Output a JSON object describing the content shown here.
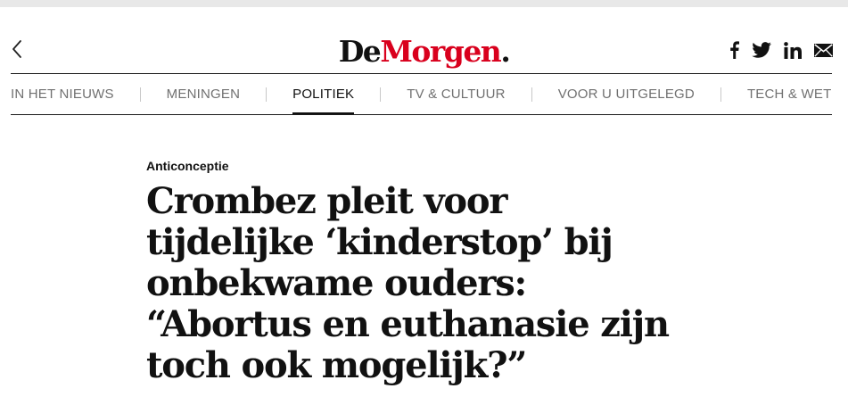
{
  "header": {
    "back_icon": "chevron-left-icon",
    "logo": {
      "part1": "De",
      "part2": "Morgen",
      "dot": ".",
      "brand_color": "#d9001d"
    },
    "share_icons": [
      "facebook-icon",
      "twitter-icon",
      "linkedin-icon",
      "mail-icon"
    ]
  },
  "nav": {
    "items": [
      {
        "label": "IN HET NIEUWS",
        "active": false
      },
      {
        "label": "MENINGEN",
        "active": false
      },
      {
        "label": "POLITIEK",
        "active": true
      },
      {
        "label": "TV & CULTUUR",
        "active": false
      },
      {
        "label": "VOOR U UITGELEGD",
        "active": false
      },
      {
        "label": "TECH & WETENSCHAP",
        "active": false
      }
    ]
  },
  "article": {
    "kicker": "Anticonceptie",
    "title": "Crombez pleit voor tijdelijke ‘kinderstop’ bij onbekwame ouders: “Abortus en euthanasie zijn toch ook mogelijk?”"
  }
}
